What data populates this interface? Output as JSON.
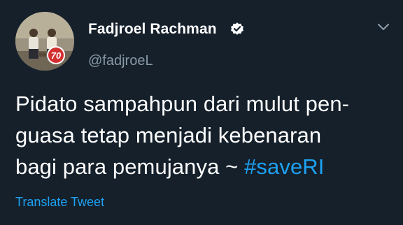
{
  "author": {
    "display_name": "Fadjroel Rachman",
    "handle": "@fadjroeL",
    "verified": true,
    "avatar_badge_text": "70"
  },
  "tweet": {
    "line1": "Pidato sampahpun dari mulut pen-",
    "line2": "guasa tetap menjadi kebenaran",
    "line3_text": "bagi para pemujanya ~ ",
    "hashtag": "#saveRI"
  },
  "translate_label": "Translate Tweet",
  "icons": {
    "verified": "verified-badge-icon",
    "menu": "chevron-down-icon"
  },
  "colors": {
    "background": "#15202b",
    "primary_text": "#ffffff",
    "secondary_text": "#8899a6",
    "link": "#1da1f2"
  }
}
